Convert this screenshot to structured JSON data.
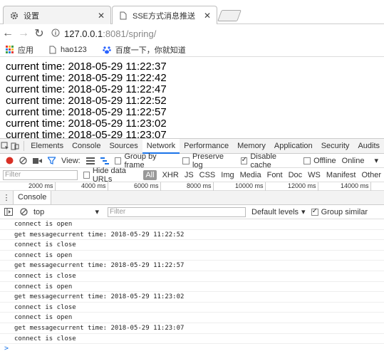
{
  "tabs": [
    {
      "title": "设置",
      "icon": "gear-icon"
    },
    {
      "title": "SSE方式消息推送",
      "icon": "document-icon"
    }
  ],
  "address": {
    "host": "127.0.0.1",
    "rest": ":8081/spring/"
  },
  "bookmarks": [
    {
      "label": "应用",
      "icon": "apps-grid-icon"
    },
    {
      "label": "hao123",
      "icon": "page-icon"
    },
    {
      "label": "百度一下，你就知道",
      "icon": "baidu-paw-icon"
    }
  ],
  "page_lines": [
    "current time: 2018-05-29 11:22:37",
    "current time: 2018-05-29 11:22:42",
    "current time: 2018-05-29 11:22:47",
    "current time: 2018-05-29 11:22:52",
    "current time: 2018-05-29 11:22:57",
    "current time: 2018-05-29 11:23:02",
    "current time: 2018-05-29 11:23:07"
  ],
  "devtools": {
    "tabs": [
      "Elements",
      "Console",
      "Sources",
      "Network",
      "Performance",
      "Memory",
      "Application",
      "Security",
      "Audits"
    ],
    "active_tab": "Network",
    "network_toolbar": {
      "view_label": "View:",
      "group_by_frame": "Group by frame",
      "preserve_log": "Preserve log",
      "disable_cache": "Disable cache",
      "offline": "Offline",
      "throttle": "Online"
    },
    "filter_placeholder": "Filter",
    "hide_data_urls": "Hide data URLs",
    "types": [
      "All",
      "XHR",
      "JS",
      "CSS",
      "Img",
      "Media",
      "Font",
      "Doc",
      "WS",
      "Manifest",
      "Other"
    ],
    "timeline_ticks": [
      "2000 ms",
      "4000 ms",
      "6000 ms",
      "8000 ms",
      "10000 ms",
      "12000 ms",
      "14000 ms"
    ],
    "drawer_tab": "Console",
    "console_toolbar": {
      "context": "top",
      "filter_placeholder": "Filter",
      "levels": "Default levels",
      "group_similar": "Group similar"
    },
    "console_messages": [
      "connect is open",
      "get messagecurrent time: 2018-05-29 11:22:52",
      "connect is close",
      "connect is open",
      "get messagecurrent time: 2018-05-29 11:22:57",
      "connect is close",
      "connect is open",
      "get messagecurrent time: 2018-05-29 11:23:02",
      "connect is close",
      "connect is open",
      "get messagecurrent time: 2018-05-29 11:23:07",
      "connect is close"
    ],
    "prompt": ">"
  }
}
